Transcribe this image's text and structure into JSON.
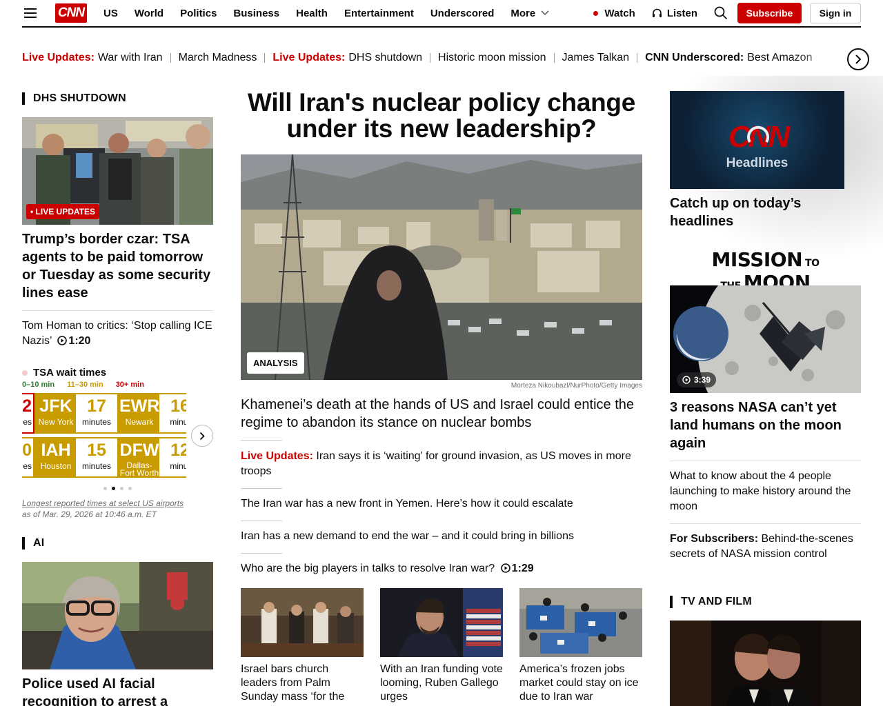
{
  "header": {
    "nav": [
      "US",
      "World",
      "Politics",
      "Business",
      "Health",
      "Entertainment",
      "Underscored"
    ],
    "more_label": "More",
    "watch_label": "Watch",
    "listen_label": "Listen",
    "subscribe_label": "Subscribe",
    "signin_label": "Sign in",
    "logo_text": "CNN"
  },
  "ticker": [
    {
      "label": "Live Updates:",
      "text": "War with Iran"
    },
    {
      "label": "",
      "text": "March Madness"
    },
    {
      "label": "Live Updates:",
      "text": "DHS shutdown"
    },
    {
      "label": "",
      "text": "Historic moon mission"
    },
    {
      "label": "",
      "text": "James Talkan"
    },
    {
      "label": "CNN Underscored:",
      "text": "Best Amazon"
    }
  ],
  "left": {
    "section1_title": "DHS SHUTDOWN",
    "live_badge": "• LIVE UPDATES",
    "headline": "Trump’s border czar: TSA agents to be paid tomorrow or Tuesday as some security lines ease",
    "story1_text": "Tom Homan to critics: ‘Stop calling ICE Nazis’",
    "story1_duration": "1:20",
    "section2_title": "AI",
    "headline2": "Police used AI facial recognition to arrest a"
  },
  "tsa": {
    "title": "TSA wait times",
    "legend": [
      "0–10 min",
      "11–30 min",
      "30+ min"
    ],
    "cards": [
      {
        "code": "JFK",
        "city": "New York",
        "minutes": "17",
        "unit": "minutes"
      },
      {
        "code": "EWR",
        "city": "Newark",
        "minutes": "16",
        "unit": "minut"
      },
      {
        "code": "IAH",
        "city": "Houston",
        "minutes": "15",
        "unit": "minutes"
      },
      {
        "code": "DFW",
        "city": "Dallas-Fort Worth",
        "minutes": "12",
        "unit": "minut"
      }
    ],
    "partial_left_top": {
      "code": "2",
      "unit": "es"
    },
    "partial_left_bottom": {
      "code": "0",
      "unit": "es"
    },
    "note_link": "Longest reported times at select US airports",
    "note_time": "as of Mar. 29, 2026 at 10:46 a.m. ET"
  },
  "center": {
    "title": "Will Iran's nuclear policy change under its new leadership?",
    "badge": "ANALYSIS",
    "credit": "Morteza Nikoubazl/NurPhoto/Getty Images",
    "subhead": "Khamenei’s death at the hands of US and Israel could entice the regime to abandon its stance on nuclear bombs",
    "stories": [
      {
        "label": "Live Updates:",
        "text": "Iran says it is ‘waiting’ for ground invasion, as US moves in more troops"
      },
      {
        "label": "",
        "text": "The Iran war has a new front in Yemen. Here’s how it could escalate"
      },
      {
        "label": "",
        "text": "Iran has a new demand to end the war – and it could bring in billions"
      },
      {
        "label": "",
        "text": "Who are the big players in talks to resolve Iran war?",
        "duration": "1:29"
      }
    ],
    "thumbs": [
      "Israel bars church leaders from Palm Sunday mass ‘for the",
      "With an Iran funding vote looming, Ruben Gallego urges",
      "America’s frozen jobs market could stay on ice due to Iran war"
    ]
  },
  "right": {
    "headlines_logo": "CNN",
    "headlines_word": "Headlines",
    "headlines_caption": "Catch up on today’s headlines",
    "mission_a": "MISSION",
    "mission_b": "TO THE",
    "mission_c": "MOON",
    "video_duration": "3:39",
    "moon_headline": "3 reasons NASA can’t yet land humans on the moon again",
    "story1": "What to know about the 4 people launching to make history around the moon",
    "story2_label": "For Subscribers:",
    "story2_text": "Behind-the-scenes secrets of NASA mission control",
    "section_title": "TV AND FILM"
  }
}
